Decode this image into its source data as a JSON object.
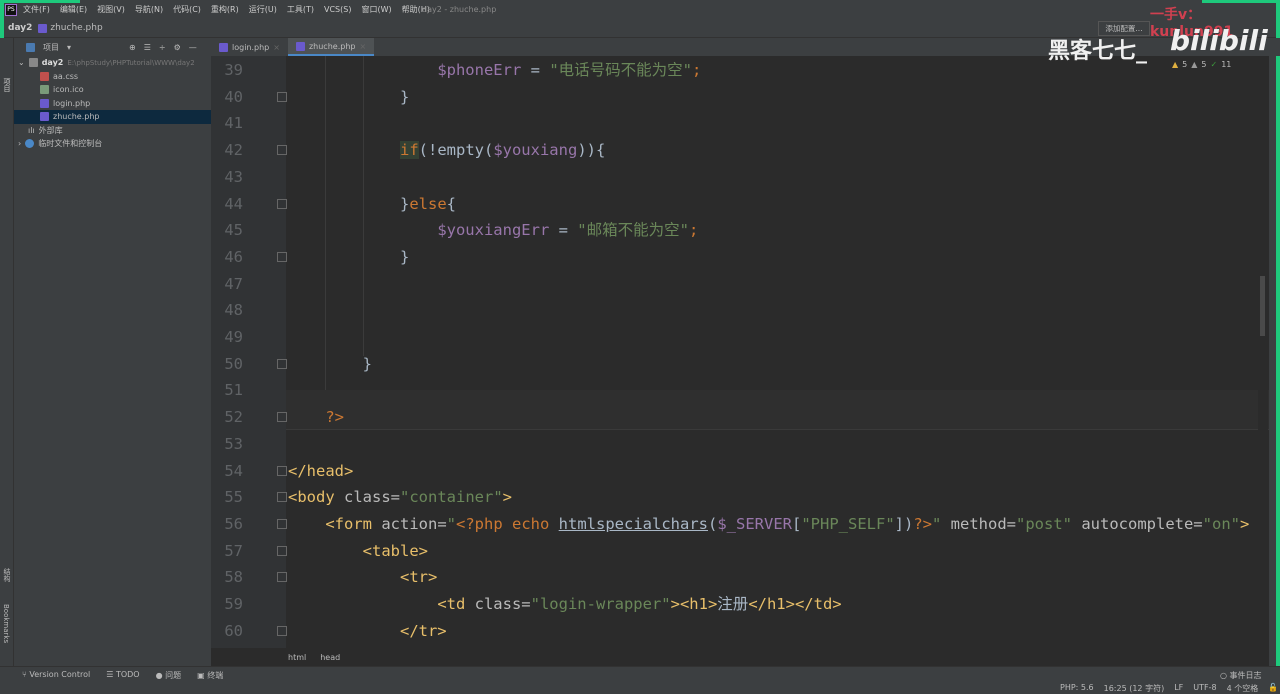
{
  "menu": {
    "items": [
      "文件(F)",
      "编辑(E)",
      "视图(V)",
      "导航(N)",
      "代码(C)",
      "重构(R)",
      "运行(U)",
      "工具(T)",
      "VCS(S)",
      "窗口(W)",
      "帮助(H)"
    ],
    "title": "day2 - zhuche.php",
    "logo": "PS"
  },
  "nav": {
    "project": "day2",
    "file": "zhuche.php"
  },
  "project": {
    "label": "项目",
    "root": "day2",
    "root_path": "E:\\phpStudy\\PHPTutorial\\WWW\\day2",
    "files": [
      "aa.css",
      "icon.ico",
      "login.php",
      "zhuche.php"
    ],
    "external": "外部库",
    "scratches": "临时文件和控制台"
  },
  "left_tools": {
    "project": "项目",
    "structure": "结构",
    "bookmarks": "Bookmarks"
  },
  "tabs": [
    "login.php",
    "zhuche.php"
  ],
  "toolbar": {
    "add_config": "添加配置..."
  },
  "inspections": {
    "warnings": "5",
    "weak": "5",
    "ok": "11"
  },
  "watermark": {
    "top": "一手v：kunlun991",
    "channel": "黑客七七_",
    "logo": "bilibili"
  },
  "code": [
    {
      "n": "39",
      "t": [
        [
          "                ",
          ""
        ],
        [
          "$phoneErr",
          "var"
        ],
        [
          " = ",
          ""
        ],
        [
          "\"电话号码不能为空\"",
          "str"
        ],
        [
          ";",
          "kw"
        ]
      ]
    },
    {
      "n": "40",
      "t": [
        [
          "            }",
          ""
        ]
      ]
    },
    {
      "n": "41",
      "t": []
    },
    {
      "n": "42",
      "t": [
        [
          "            ",
          ""
        ],
        [
          "if",
          "kw hl"
        ],
        [
          "(!empty(",
          ""
        ],
        [
          "$youxiang",
          "var"
        ],
        [
          ")){",
          ""
        ]
      ]
    },
    {
      "n": "43",
      "t": []
    },
    {
      "n": "44",
      "t": [
        [
          "            }",
          ""
        ],
        [
          "else",
          "kw"
        ],
        [
          "{",
          ""
        ]
      ]
    },
    {
      "n": "45",
      "t": [
        [
          "                ",
          ""
        ],
        [
          "$youxiangErr",
          "var"
        ],
        [
          " = ",
          ""
        ],
        [
          "\"邮箱不能为空\"",
          "str"
        ],
        [
          ";",
          "kw"
        ]
      ]
    },
    {
      "n": "46",
      "t": [
        [
          "            }",
          ""
        ]
      ]
    },
    {
      "n": "47",
      "t": []
    },
    {
      "n": "48",
      "t": []
    },
    {
      "n": "49",
      "t": []
    },
    {
      "n": "50",
      "t": [
        [
          "        }",
          ""
        ]
      ]
    },
    {
      "n": "51",
      "t": []
    },
    {
      "n": "52",
      "t": [
        [
          "    ",
          ""
        ],
        [
          "?>",
          "php"
        ]
      ]
    },
    {
      "n": "53",
      "t": []
    },
    {
      "n": "54",
      "t": [
        [
          "</head>",
          "tag"
        ]
      ]
    },
    {
      "n": "55",
      "t": [
        [
          "<body ",
          "tag"
        ],
        [
          "class=",
          "attr"
        ],
        [
          "\"container\"",
          "str"
        ],
        [
          ">",
          "tag"
        ]
      ]
    },
    {
      "n": "56",
      "t": [
        [
          "    ",
          ""
        ],
        [
          "<form ",
          "tag"
        ],
        [
          "action=",
          "attr"
        ],
        [
          "\"",
          "str"
        ],
        [
          "<?php ",
          "php"
        ],
        [
          "echo ",
          "kw"
        ],
        [
          "htmlspecialchars",
          "fn"
        ],
        [
          "(",
          ""
        ],
        [
          "$_SERVER",
          "var"
        ],
        [
          "[",
          ""
        ],
        [
          "\"PHP_SELF\"",
          "str"
        ],
        [
          "])",
          ""
        ],
        [
          "?>",
          "php"
        ],
        [
          "\" ",
          "str"
        ],
        [
          "method=",
          "attr"
        ],
        [
          "\"post\" ",
          "str"
        ],
        [
          "autocomplete=",
          "attr"
        ],
        [
          "\"on\"",
          "str"
        ],
        [
          ">",
          "tag"
        ]
      ]
    },
    {
      "n": "57",
      "t": [
        [
          "        ",
          ""
        ],
        [
          "<table>",
          "tag"
        ]
      ]
    },
    {
      "n": "58",
      "t": [
        [
          "            ",
          ""
        ],
        [
          "<tr>",
          "tag"
        ]
      ]
    },
    {
      "n": "59",
      "t": [
        [
          "                ",
          ""
        ],
        [
          "<td ",
          "tag"
        ],
        [
          "class=",
          "attr"
        ],
        [
          "\"login-wrapper\"",
          "str"
        ],
        [
          "><h1>",
          "tag"
        ],
        [
          "注册",
          ""
        ],
        [
          "</h1></td>",
          "tag"
        ]
      ]
    },
    {
      "n": "60",
      "t": [
        [
          "            ",
          ""
        ],
        [
          "</tr>",
          "tag"
        ]
      ]
    }
  ],
  "breadcrumbs": [
    "html",
    "head"
  ],
  "status": {
    "vcs": "Version Control",
    "todo": "TODO",
    "problems": "问题",
    "terminal": "终端",
    "event_log": "事件日志",
    "php": "PHP: 5.6",
    "position": "16:25 (12 字符)",
    "line_sep": "LF",
    "encoding": "UTF-8",
    "indent": "4 个空格"
  }
}
